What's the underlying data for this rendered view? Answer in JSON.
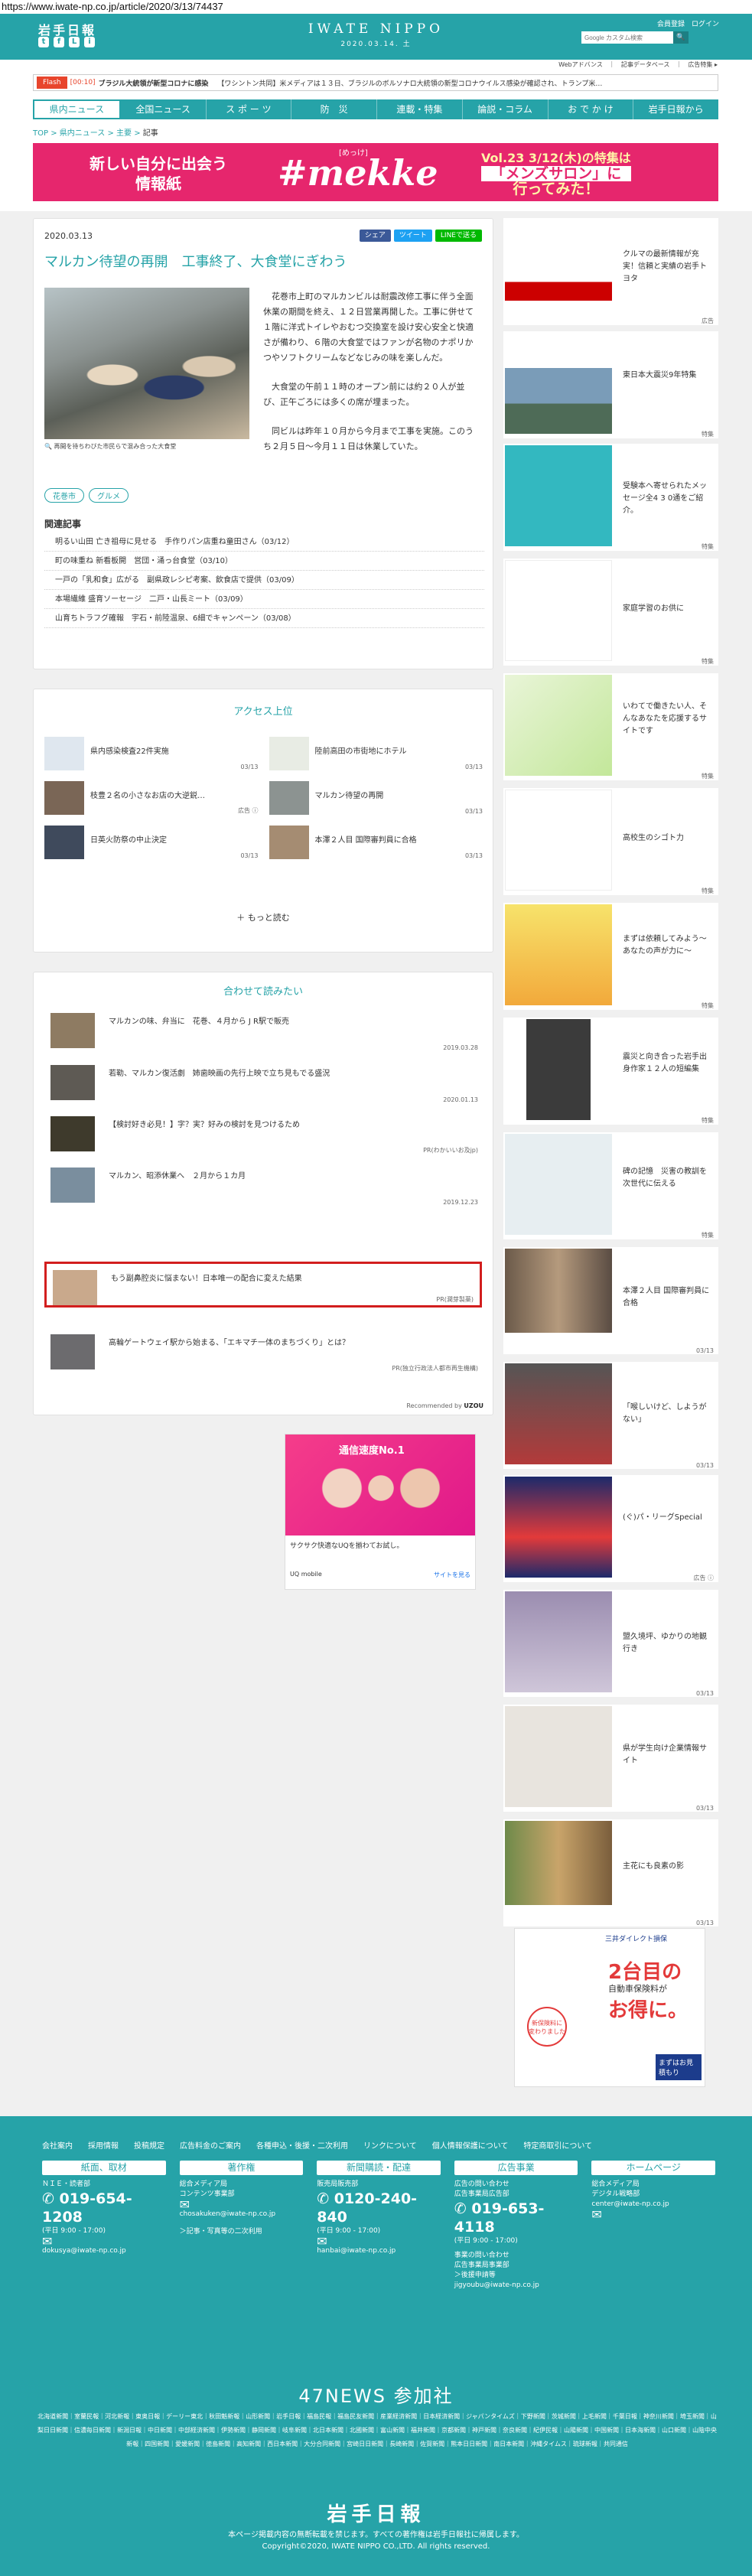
{
  "browser": {
    "url": "https://www.iwate-np.co.jp/article/2020/3/13/74437"
  },
  "header": {
    "logo": "岩手日報",
    "social": [
      "t",
      "f",
      "L",
      "i"
    ],
    "brand": "IWATE NIPPO",
    "date": "2020.03.14. 土",
    "links": "会員登録　ログイン",
    "search_placeholder": "Google カスタム検索",
    "search_btn": "🔍",
    "sublinks": "Webアドバンス　｜　記事データベース　｜　広告特集 ▸"
  },
  "flash": {
    "label": "Flash",
    "time": "[00:10]",
    "headline": "ブラジル大統領が新型コロナに感染",
    "ticker": "【ワシントン共同】米メディアは１３日、ブラジルのボルソナロ大統領の新型コロナウイルス感染が確認され、トランプ米…"
  },
  "nav": [
    "県内ニュース",
    "全国ニュース",
    "ス ポ ー ツ",
    "防　災",
    "連載・特集",
    "論説・コラム",
    "お で か け",
    "岩手日報から"
  ],
  "breadcrumb": {
    "a": "TOP",
    "b": "県内ニュース",
    "c": "主要",
    "d": "記事"
  },
  "banner": {
    "left": "新しい自分に出会う\n情報紙",
    "small": "[めっけ]",
    "name": "#mekke",
    "right_a": "Vol.23 3/12(木)の特集は",
    "right_b": "「メンズサロン」に",
    "right_c": "行ってみた！"
  },
  "article": {
    "date": "2020.03.13",
    "share": [
      "シェア",
      "ツイート",
      "LINEで送る"
    ],
    "title": "マルカン待望の再開　工事終了、大食堂にぎわう",
    "caption": "再開を待ちわびた市民らで混み合った大食堂",
    "body": [
      "花巻市上町のマルカンビルは耐震改修工事に伴う全面休業の期間を終え、１２日営業再開した。工事に併せて１階に洋式トイレやおむつ交換室を設け安心安全と快適さが備わり、６階の大食堂ではファンが名物のナポリかつやソフトクリームなどなじみの味を楽しんだ。",
      "大食堂の午前１１時のオープン前には約２０人が並び、正午ごろには多くの席が埋まった。",
      "同ビルは昨年１０月から今月まで工事を実施。このうち２月５日～今月１１日は休業していた。"
    ],
    "tags": [
      "花巻市",
      "グルメ"
    ],
    "related_heading": "関連記事",
    "related": [
      "明るい山田 亡き祖母に見せる　手作りパン店重ね童田さん（03/12）",
      "町の味重ね 新看板開　営団・涌っ台食堂（03/10）",
      "一戸の「乳和食」広がる　副県政レシピ考案、飲食店で提供（03/09）",
      "本場繊維 盛育ソーセージ　二戸・山長ミート（03/09）",
      "山育ちトラフグ確報　宇石・前陸温泉、6細でキャンペーン（03/08）"
    ]
  },
  "ranking": {
    "heading": "アクセス上位",
    "items": [
      {
        "title": "県内感染検査22件実施",
        "date": "03/13"
      },
      {
        "title": "陸前高田の市街地にホテル",
        "date": "03/13"
      },
      {
        "title": "枝豊２名の小さなお店の大逆鋭…",
        "date": "広告 ⓘ"
      },
      {
        "title": "マルカン待望の再開",
        "date": "03/13"
      },
      {
        "title": "日英火防祭の中止決定",
        "date": "03/13"
      },
      {
        "title": "本澤２人目 国際審判員に合格",
        "date": "03/13"
      }
    ],
    "more": "＋ もっと読む"
  },
  "together": {
    "heading": "合わせて読みたい",
    "items": [
      {
        "title": "マルカンの味、弁当に　花巻、４月から J R駅で販売",
        "meta": "2019.03.28"
      },
      {
        "title": "若勒、マルカン復活劇　姉歯映画の先行上映で立ち見もでる盛況",
        "meta": "2020.01.13"
      },
      {
        "title": "【検討好き必見！】字？実？好みの検討を見つけるため",
        "meta": "PR(わかいいお及jp)"
      },
      {
        "title": "マルカン、昭添休業へ　２月から１カ月",
        "meta": "2019.12.23"
      },
      {
        "title": "もう副鼻腔炎に悩まない！日本唯一の配合に変えた結果",
        "meta": "PR(潤芽製薬)"
      },
      {
        "title": "高輪ゲートウェイ駅から始まる、「エキマチ一体のまちづくり」とは？",
        "meta": "PR(独立行政法人都市再生機構)"
      }
    ],
    "recommended": "Recommended by",
    "recommended_brand": "UZOU"
  },
  "ad": {
    "top": "通信速度No.1",
    "caption": "サクサク快適なUQを揃わてお試し。",
    "brand": "UQ mobile",
    "cta": "サイトを見る"
  },
  "sidebar": [
    {
      "text": "クルマの最新情報が充実！信頼と実績の岩手トヨタ",
      "label": "広告"
    },
    {
      "text": "東日本大震災9年特集",
      "label": "特集"
    },
    {
      "text": "受験本へ寄せられたメッセージ全4 3 0通をご紹介。",
      "label": "特集"
    },
    {
      "text": "家庭学習のお供に",
      "label": "特集"
    },
    {
      "text": "いわてで働きたい人、そんなあなたを応援するサイトです",
      "label": "特集"
    },
    {
      "text": "高校生のシゴト力",
      "label": "特集"
    },
    {
      "text": "まずは依頼してみよう～あなたの声が力に～",
      "label": "特集"
    },
    {
      "text": "震災と向き合った岩手出身作家１２人の短編集",
      "label": "特集"
    },
    {
      "text": "碑の記憶　災害の教訓を次世代に伝える",
      "label": "特集"
    },
    {
      "text": "本澤２人目 国際審判員に合格",
      "label": "03/13"
    },
    {
      "text": "「喉しいけど、しようがない」",
      "label": "03/13"
    },
    {
      "text": "(ぐ)パ・リーグSpecial",
      "label": "広告 ⓘ"
    },
    {
      "text": "盟久境坪、ゆかりの地観行き",
      "label": "03/13"
    },
    {
      "text": "県が学生向け企業情報サイト",
      "label": "03/13"
    },
    {
      "text": "主花にも良素の影",
      "label": "03/13"
    }
  ],
  "side_ad": {
    "brand": "三井ダイレクト損保",
    "big": "2台目の",
    "sub": "自動車保険料が",
    "em": "お得に。",
    "b1": "新保険料に",
    "b2": "変わりました",
    "cta": "まずはお見積もり"
  },
  "footer": {
    "links": [
      "会社案内",
      "採用情報",
      "投稿規定",
      "広告料金のご案内",
      "各種申込・後援・二次利用",
      "リンクについて",
      "個人情報保護について",
      "特定商取引について"
    ],
    "cols": [
      {
        "h": "紙面、取材",
        "sub": "ＮＩＥ・読者部",
        "tel": "019-654-1208",
        "hours": "(平日 9:00 - 17:00)",
        "mail": "dokusya@iwate-np.co.jp"
      },
      {
        "h": "著作権",
        "sub": "総合メディア局\nコンテンツ事業部",
        "tel": "",
        "hours": "",
        "mail": "chosakuken@iwate-np.co.jp",
        "note": "＞記事・写真等の二次利用"
      },
      {
        "h": "新聞購読・配達",
        "sub": "販売局販売部",
        "tel": "0120-240-840",
        "hours": "(平日 9:00 - 17:00)",
        "mail": "hanbai@iwate-np.co.jp"
      },
      {
        "h": "広告事業",
        "sub": "広告の問い合わせ\n広告事業局広告部",
        "tel": "019-653-4118",
        "hours": "(平日 9:00 - 17:00)",
        "mail": "jigyoubu@iwate-np.co.jp",
        "note": "事業の問い合わせ\n広告事業局事業部\n＞後援申請等"
      },
      {
        "h": "ホームページ",
        "sub": "総合メディア局\nデジタル戦略部",
        "tel": "",
        "hours": "",
        "mail": "center@iwate-np.co.jp"
      }
    ],
    "n47_heading": "47NEWS 参加社",
    "n47": "北海道新聞｜室蘭民報｜河北新報｜東奥日報｜デーリー東北｜秋田魁新報｜山形新聞｜岩手日報｜福島民報｜福島民友新聞｜産業経済新聞｜日本経済新聞｜ジャパンタイムズ｜下野新聞｜茨城新聞｜上毛新聞｜千葉日報｜神奈川新聞｜埼玉新聞｜山梨日日新聞｜信濃毎日新聞｜新潟日報｜中日新聞｜中部経済新聞｜伊勢新聞｜静岡新聞｜岐阜新聞｜北日本新聞｜北國新聞｜富山新聞｜福井新聞｜京都新聞｜神戸新聞｜奈良新聞｜紀伊民報｜山陽新聞｜中国新聞｜日本海新聞｜山口新聞｜山陰中央新報｜四国新聞｜愛媛新聞｜徳島新聞｜高知新聞｜西日本新聞｜大分合同新聞｜宮崎日日新聞｜長崎新聞｜佐賀新聞｜熊本日日新聞｜南日本新聞｜沖縄タイムス｜琉球新報｜共同通信",
    "logo": "岩手日報",
    "copy1": "本ページ掲載内容の無断転載を禁じます。すべての著作権は岩手日報社に帰属します。",
    "copy2": "Copyright©2020, IWATE NIPPO CO.,LTD. All rights reserved."
  },
  "colors": {
    "brand": "#26a3a8",
    "banner": "#e6266d",
    "flash": "#e8452c",
    "highlight": "#d21e1e"
  }
}
